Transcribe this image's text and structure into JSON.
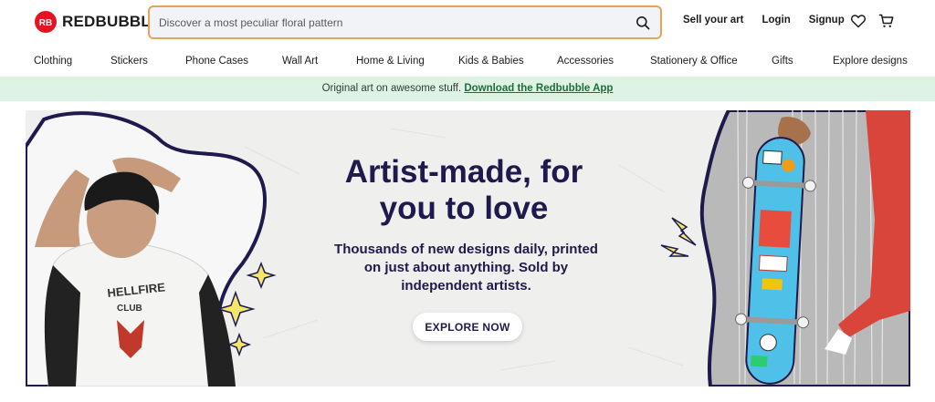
{
  "brand": {
    "name": "REDBUBBLE",
    "color": "#e41321"
  },
  "search": {
    "placeholder": "Discover a most peculiar floral pattern",
    "icon": "search-icon"
  },
  "top_links": {
    "sell": "Sell your art",
    "login": "Login",
    "signup": "Signup"
  },
  "top_icons": [
    "heart-icon",
    "cart-icon"
  ],
  "categories": [
    "Clothing",
    "Stickers",
    "Phone Cases",
    "Wall Art",
    "Home & Living",
    "Kids & Babies",
    "Accessories",
    "Stationery & Office",
    "Gifts",
    "Explore designs"
  ],
  "promo": {
    "text": "Original art on awesome stuff. ",
    "link": "Download the Redbubble App"
  },
  "hero": {
    "heading": "Artist-made, for you to love",
    "subheading": "Thousands of new designs daily, printed on just about anything. Sold by independent artists.",
    "cta": "EXPLORE NOW",
    "heading_color": "#1f1a4d"
  },
  "colors": {
    "promo_bg": "#dff3e4",
    "search_border": "#e8a35a",
    "accent_yellow": "#f4e56b",
    "skateboard": "#4fc0e8"
  }
}
